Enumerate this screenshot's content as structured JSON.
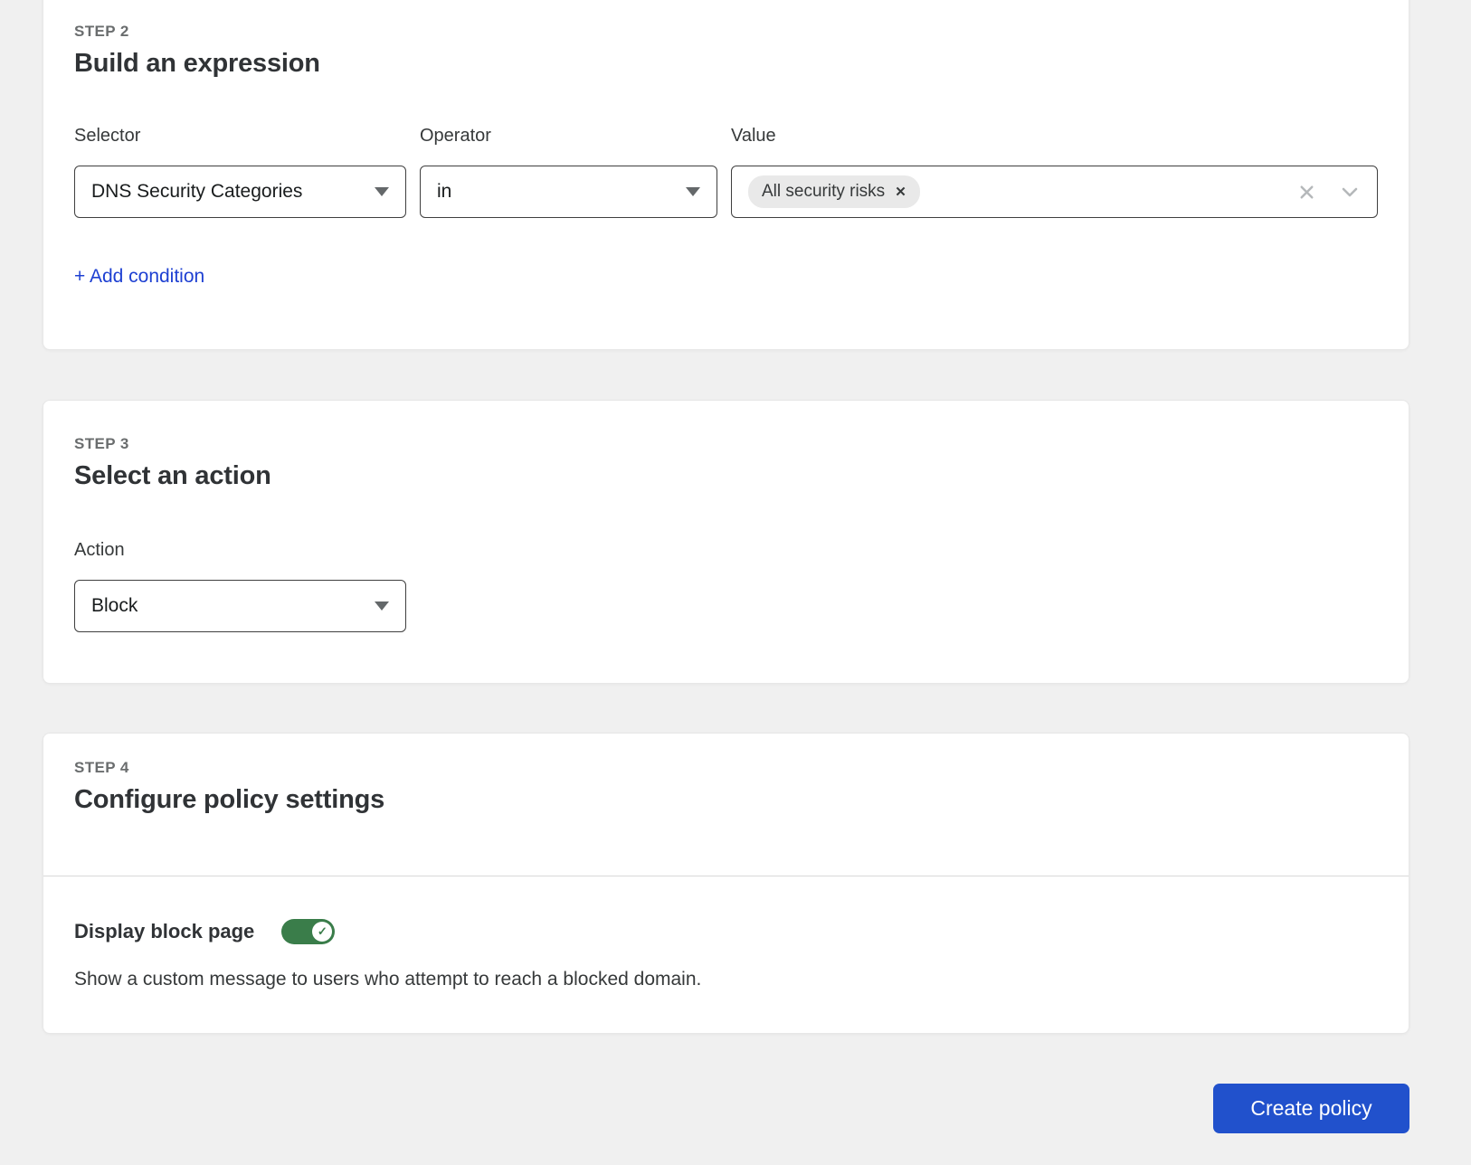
{
  "step2": {
    "step_label": "STEP 2",
    "title": "Build an expression",
    "selector": {
      "label": "Selector",
      "value": "DNS Security Categories"
    },
    "operator": {
      "label": "Operator",
      "value": "in"
    },
    "value": {
      "label": "Value",
      "chips": [
        {
          "label": "All security risks"
        }
      ]
    },
    "add_condition_label": "+ Add condition"
  },
  "step3": {
    "step_label": "STEP 3",
    "title": "Select an action",
    "action": {
      "label": "Action",
      "value": "Block"
    }
  },
  "step4": {
    "step_label": "STEP 4",
    "title": "Configure policy settings",
    "display_block_page": {
      "label": "Display block page",
      "enabled": true,
      "description": "Show a custom message to users who attempt to reach a blocked domain."
    }
  },
  "footer": {
    "create_button_label": "Create policy"
  },
  "icons": {
    "chip_remove": "✕",
    "check": "✓",
    "chevron_down": "css-triangle-down",
    "clear": "svg-x-stroke"
  },
  "colors": {
    "page_background": "#f0f0f0",
    "card_background": "#ffffff",
    "link_blue": "#1e40d2",
    "button_blue": "#2151cc",
    "toggle_green": "#3a7d4a",
    "control_border": "#3f3f3f",
    "muted_icon": "#b5b8ba",
    "divider": "#d9d9d9",
    "step_label_gray": "#6a6d6e"
  }
}
